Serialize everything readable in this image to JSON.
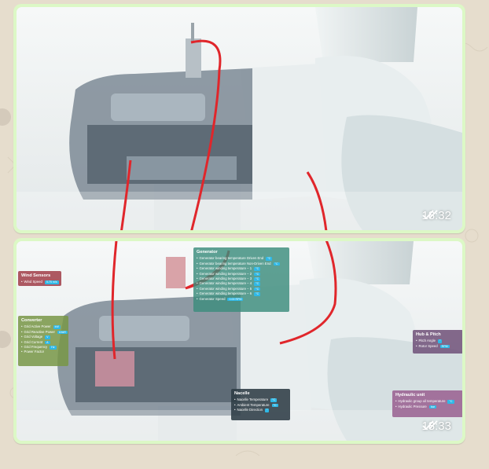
{
  "messages": [
    {
      "time": "18:32",
      "status_icon": "double-check-icon"
    },
    {
      "time": "18:33",
      "status_icon": "double-check-icon",
      "panels": {
        "generator": {
          "title": "Generator",
          "rows": [
            "Generator bearing temperature Driven End",
            "Generator bearing temperature Non-Driven End",
            "Generator winding temperature – 1",
            "Generator winding temperature – 2",
            "Generator winding temperature – 3",
            "Generator winding temperature – 4",
            "Generator winding temperature – 5",
            "Generator winding temperature – 6",
            "Generator Speed"
          ],
          "values": [
            "°C",
            "°C",
            "°C",
            "°C",
            "°C",
            "°C",
            "°C",
            "°C",
            "0.00 RPM"
          ]
        },
        "wind": {
          "title": "Wind Sensors",
          "rows": [
            "Wind Speed"
          ],
          "values": [
            "0.75 m/s"
          ]
        },
        "converter": {
          "title": "Converter",
          "rows": [
            "Grid Active Power",
            "Grid Reactive Power",
            "Grid Voltage",
            "Grid Current",
            "Grid Frequency",
            "Power Factor"
          ],
          "values": [
            "kW",
            "kVAR",
            "V",
            "A",
            "Hz",
            ""
          ]
        },
        "hub": {
          "title": "Hub & Pitch",
          "rows": [
            "Pitch Angle",
            "Rotor Speed"
          ],
          "values": [
            "°",
            "RPM"
          ]
        },
        "nacelle": {
          "title": "Nacelle",
          "rows": [
            "Nacelle Temperature",
            "Ambient Temperature",
            "Nacelle Direction"
          ],
          "values": [
            "°C",
            "°C",
            "°"
          ]
        },
        "hydraulic": {
          "title": "Hydraulic unit",
          "rows": [
            "Hydraulic group oil temperature",
            "Hydraulic Pressure"
          ],
          "values": [
            "°C",
            "bar"
          ]
        }
      }
    }
  ],
  "colors": {
    "bubble": "#dcf8c6",
    "wallpaper": "#e6ddcd",
    "annotation": "#e0262b"
  }
}
